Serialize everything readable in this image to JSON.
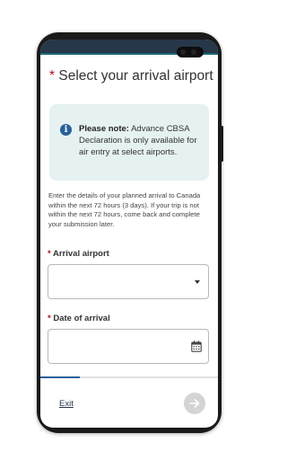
{
  "page": {
    "title": "Select your arrival airport",
    "required_mark": "*"
  },
  "note": {
    "icon": "info-icon",
    "bold": "Please note:",
    "text": " Advance CBSA Declaration is only available for air entry at select airports."
  },
  "intro": "Enter the details of your planned arrival to Canada within the next 72 hours (3 days). If your trip is not within the next 72 hours, come back and complete your submission later.",
  "fields": {
    "airport": {
      "required_mark": "*",
      "label": "Arrival airport",
      "value": ""
    },
    "date": {
      "required_mark": "*",
      "label": "Date of arrival",
      "value": ""
    }
  },
  "progress": {
    "fraction": 0.22
  },
  "footer": {
    "exit_label": "Exit",
    "next_icon": "arrow-right-icon"
  },
  "colors": {
    "header": "#26374a",
    "accent": "#1b6a75",
    "required": "#b10e1e",
    "note_bg": "#e6f1f2",
    "info_icon": "#26629b"
  }
}
